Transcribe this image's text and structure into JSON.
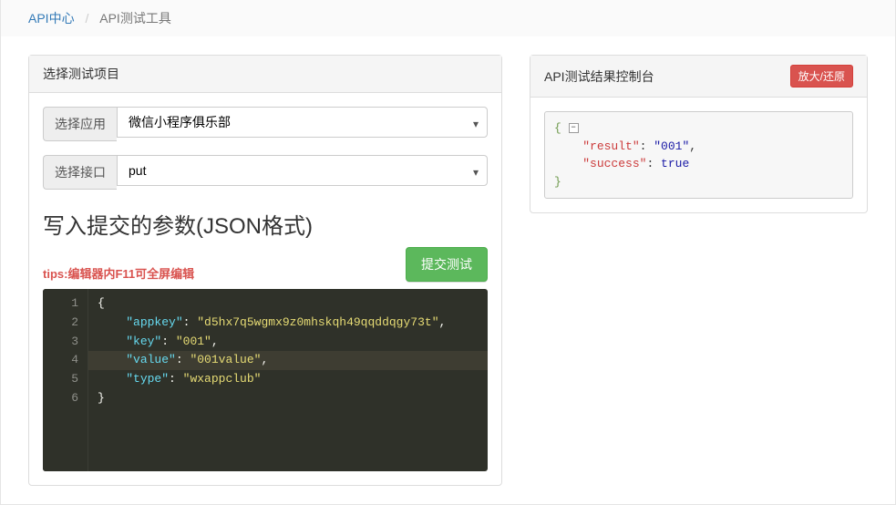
{
  "breadcrumb": {
    "root": "API中心",
    "current": "API测试工具"
  },
  "left_panel": {
    "title": "选择测试项目",
    "app_label": "选择应用",
    "app_value": "微信小程序俱乐部",
    "api_label": "选择接口",
    "api_value": "put",
    "section_title": "写入提交的参数(JSON格式)",
    "tips_prefix": "tips:",
    "tips_text": "编辑器内F11可全屏编辑",
    "submit_button": "提交测试"
  },
  "editor": {
    "lines": [
      {
        "n": 1,
        "indent": "",
        "text_raw": "{",
        "tokens": [
          {
            "t": "punc",
            "v": "{"
          }
        ]
      },
      {
        "n": 2,
        "indent": "    ",
        "tokens": [
          {
            "t": "key",
            "v": "\"appkey\""
          },
          {
            "t": "punc",
            "v": ": "
          },
          {
            "t": "str",
            "v": "\"d5hx7q5wgmx9z0mhskqh49qqddqgy73t\""
          },
          {
            "t": "punc",
            "v": ","
          }
        ]
      },
      {
        "n": 3,
        "indent": "    ",
        "tokens": [
          {
            "t": "key",
            "v": "\"key\""
          },
          {
            "t": "punc",
            "v": ": "
          },
          {
            "t": "str",
            "v": "\"001\""
          },
          {
            "t": "punc",
            "v": ","
          }
        ]
      },
      {
        "n": 4,
        "indent": "    ",
        "tokens": [
          {
            "t": "key",
            "v": "\"value\""
          },
          {
            "t": "punc",
            "v": ": "
          },
          {
            "t": "str",
            "v": "\"001value\""
          },
          {
            "t": "punc",
            "v": ","
          }
        ],
        "active": true
      },
      {
        "n": 5,
        "indent": "    ",
        "tokens": [
          {
            "t": "key",
            "v": "\"type\""
          },
          {
            "t": "punc",
            "v": ": "
          },
          {
            "t": "str",
            "v": "\"wxappclub\""
          }
        ]
      },
      {
        "n": 6,
        "indent": "",
        "text_raw": "}",
        "tokens": [
          {
            "t": "punc",
            "v": "}"
          }
        ]
      }
    ],
    "payload": {
      "appkey": "d5hx7q5wgmx9z0mhskqh49qqddqgy73t",
      "key": "001",
      "value": "001value",
      "type": "wxappclub"
    }
  },
  "right_panel": {
    "title": "API测试结果控制台",
    "toggle_button": "放大/还原",
    "collapse_glyph": "⊟",
    "result": {
      "result": "001",
      "success": true
    },
    "result_lines": [
      {
        "type": "open",
        "text": "{"
      },
      {
        "type": "kv",
        "key": "\"result\"",
        "val": "\"001\"",
        "val_type": "str",
        "comma": true
      },
      {
        "type": "kv",
        "key": "\"success\"",
        "val": "true",
        "val_type": "bool",
        "comma": false
      },
      {
        "type": "close",
        "text": "}"
      }
    ]
  }
}
